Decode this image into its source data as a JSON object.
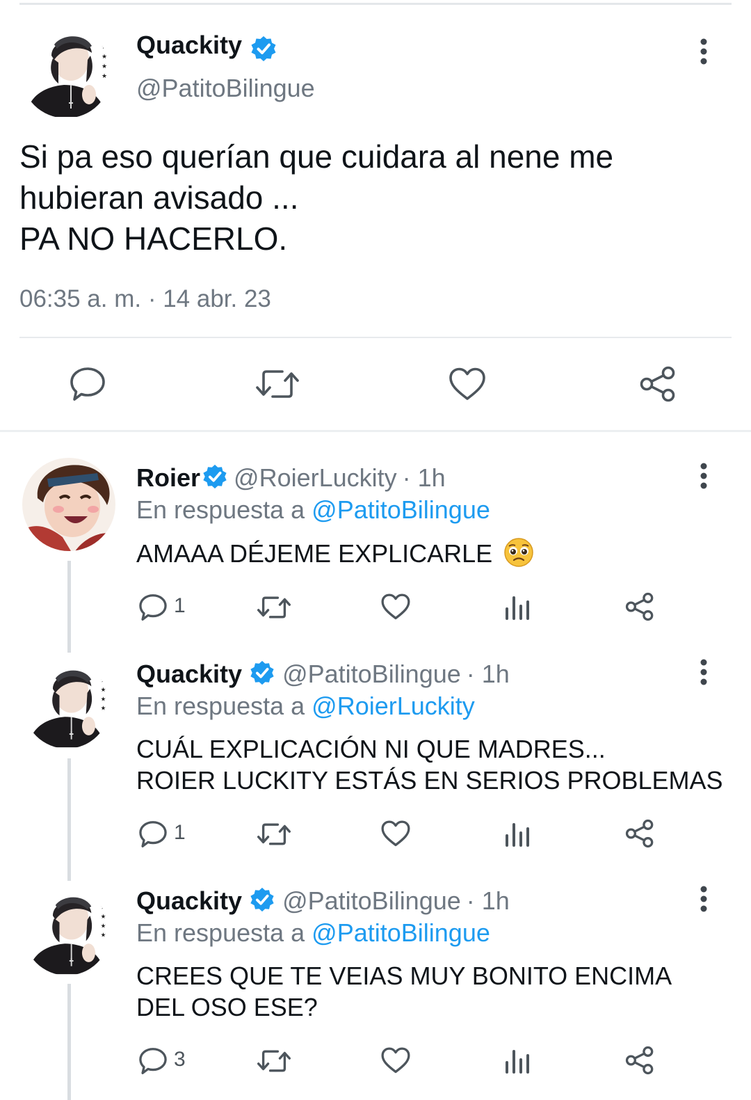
{
  "main_tweet": {
    "name": "Quackity",
    "handle": "@PatitoBilingue",
    "lines": [
      "Si pa eso querían que cuidara al nene me",
      "hubieran avisado ...",
      "PA NO HACERLO."
    ],
    "timestamp": "06:35 a. m. · 14 abr. 23"
  },
  "replies": [
    {
      "name": "Roier",
      "handle": "@RoierLuckity",
      "time": "· 1h",
      "reply_prefix": "En respuesta a",
      "reply_to": "@PatitoBilingue",
      "text": "AMAAA DÉJEME EXPLICARLE",
      "emoji": "pleading-face",
      "reply_count": "1"
    },
    {
      "name": "Quackity",
      "handle": "@PatitoBilingue",
      "time": "· 1h",
      "reply_prefix": "En respuesta a",
      "reply_to": "@RoierLuckity",
      "lines": [
        "CUÁL EXPLICACIÓN NI QUE MADRES...",
        "ROIER LUCKITY ESTÁS EN SERIOS PROBLEMAS"
      ],
      "reply_count": "1"
    },
    {
      "name": "Quackity",
      "handle": "@PatitoBilingue",
      "time": "· 1h",
      "reply_prefix": "En respuesta a",
      "reply_to": "@PatitoBilingue",
      "lines": [
        "CREES QUE TE VEIAS MUY BONITO ENCIMA",
        "DEL OSO ESE?"
      ],
      "reply_count": "3"
    }
  ],
  "colors": {
    "link": "#1d9bf0",
    "muted": "#6e7781",
    "verified": "#1d9bf0"
  }
}
